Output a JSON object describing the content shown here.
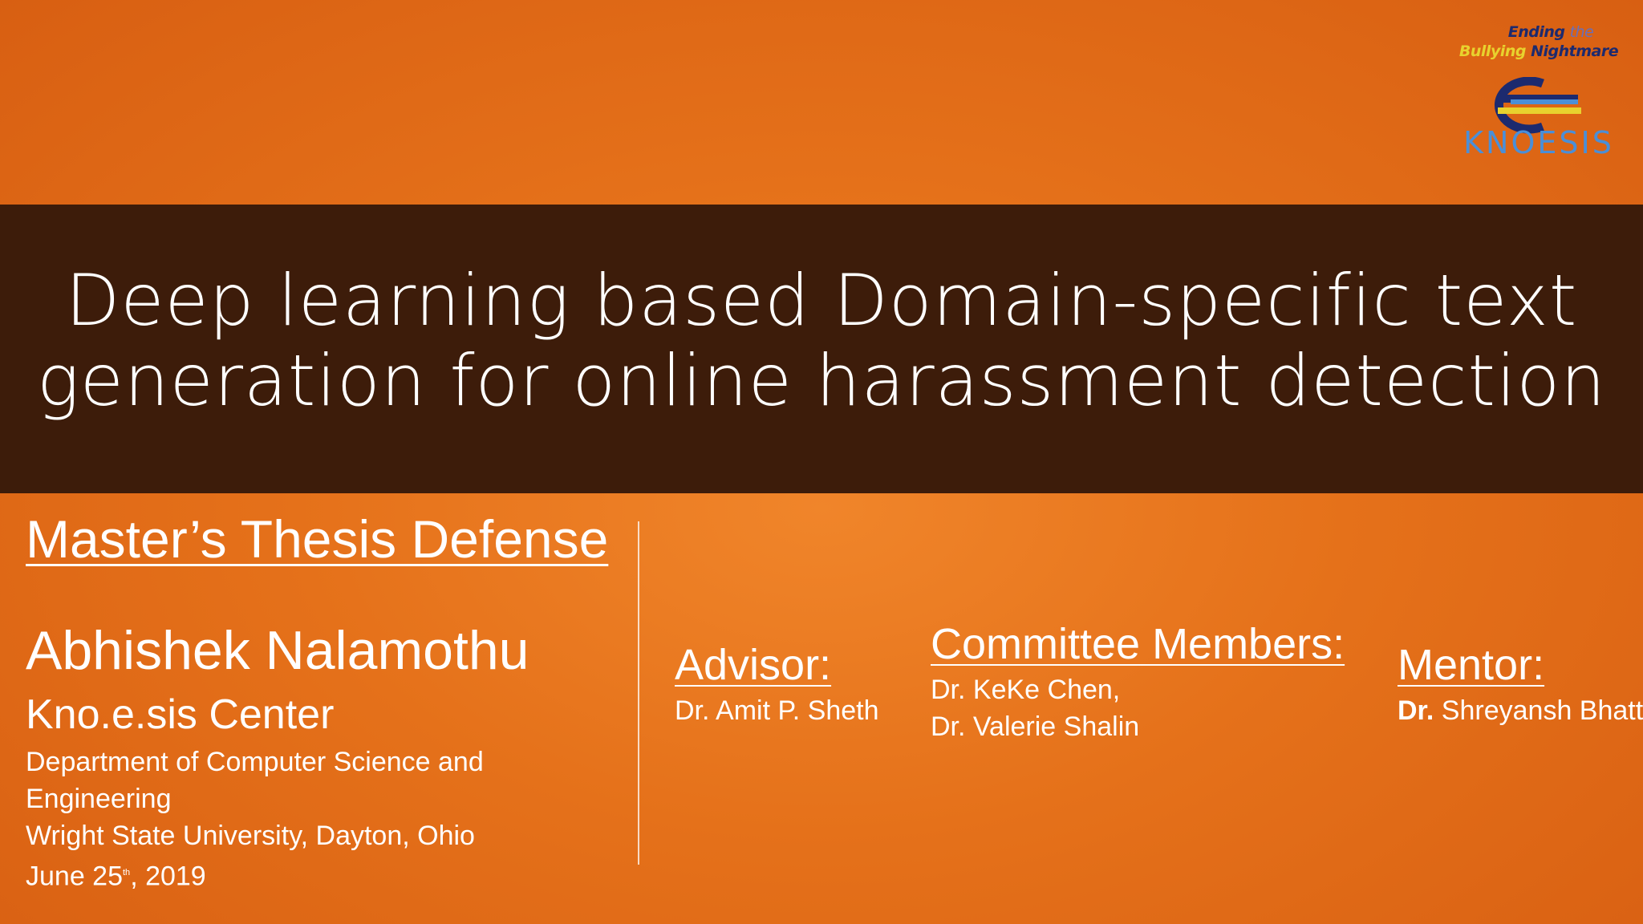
{
  "logo": {
    "tagline_line1_word1": "Ending",
    "tagline_line1_word2": "the",
    "tagline_line2_word1": "Bullying",
    "tagline_line2_word2": "Nightmare",
    "name": "KNOESIS",
    "colors": {
      "navy": "#1d2a6e",
      "yellow": "#e8d22e",
      "blue": "#4a8fd8"
    }
  },
  "title": {
    "line1": "Deep learning based Domain-specific text",
    "line2": "generation for online harassment detection"
  },
  "subtitle": "Master’s Thesis Defense",
  "presenter": {
    "name": "Abhishek Nalamothu",
    "center": "Kno.e.sis Center",
    "department_line1": "Department of Computer Science and",
    "department_line2": "Engineering",
    "university": "Wright State University, Dayton, Ohio",
    "date_prefix": "June 25",
    "date_suffix_sup": "th",
    "date_year": ", 2019"
  },
  "advisor": {
    "heading": "Advisor:",
    "name": "Dr. Amit P. Sheth"
  },
  "committee": {
    "heading": "Committee Members:",
    "member1": "Dr. KeKe Chen,",
    "member2": "Dr. Valerie Shalin"
  },
  "mentor": {
    "heading": "Mentor:",
    "name_prefix": "Dr.",
    "name": " Shreyansh Bhatt"
  },
  "colors": {
    "background": "#e5711a",
    "title_band": "#3d1c0a",
    "text": "#ffffff"
  }
}
